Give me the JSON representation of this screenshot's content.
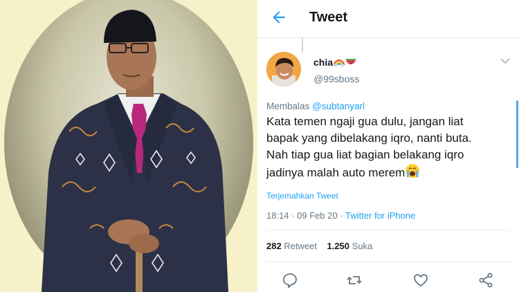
{
  "header": {
    "title": "Tweet"
  },
  "user": {
    "name": "chia",
    "handle": "@99sboss"
  },
  "tweet": {
    "replying_prefix": "Membalas",
    "replying_to": "@subtanyarl",
    "text_lines": [
      "Kata temen ngaji gua dulu, jangan liat",
      "bapak yang dibelakang iqro, nanti buta.",
      "Nah tiap gua liat bagian belakang iqro",
      "jadinya malah auto merem"
    ],
    "translate_label": "Terjemahkan Tweet",
    "time": "18:14",
    "date": "09 Feb 20",
    "dot": "·",
    "source": "Twitter for iPhone"
  },
  "stats": {
    "retweets": "282",
    "retweets_label": "Retweet",
    "likes": "1.250",
    "likes_label": "Suka"
  },
  "icons": {
    "back": "arrow-left-icon",
    "more": "chevron-down-icon",
    "reply": "comment-icon",
    "retweet": "retweet-icon",
    "like": "heart-icon",
    "share": "share-icon",
    "emoji_1": "rainbow-icon",
    "emoji_2": "watermelon-icon",
    "emoji_3": "crying-face-icon"
  },
  "colors": {
    "accent": "#1da1f2",
    "text": "#14171a",
    "muted": "#657786",
    "divider": "#e6ecf0"
  }
}
